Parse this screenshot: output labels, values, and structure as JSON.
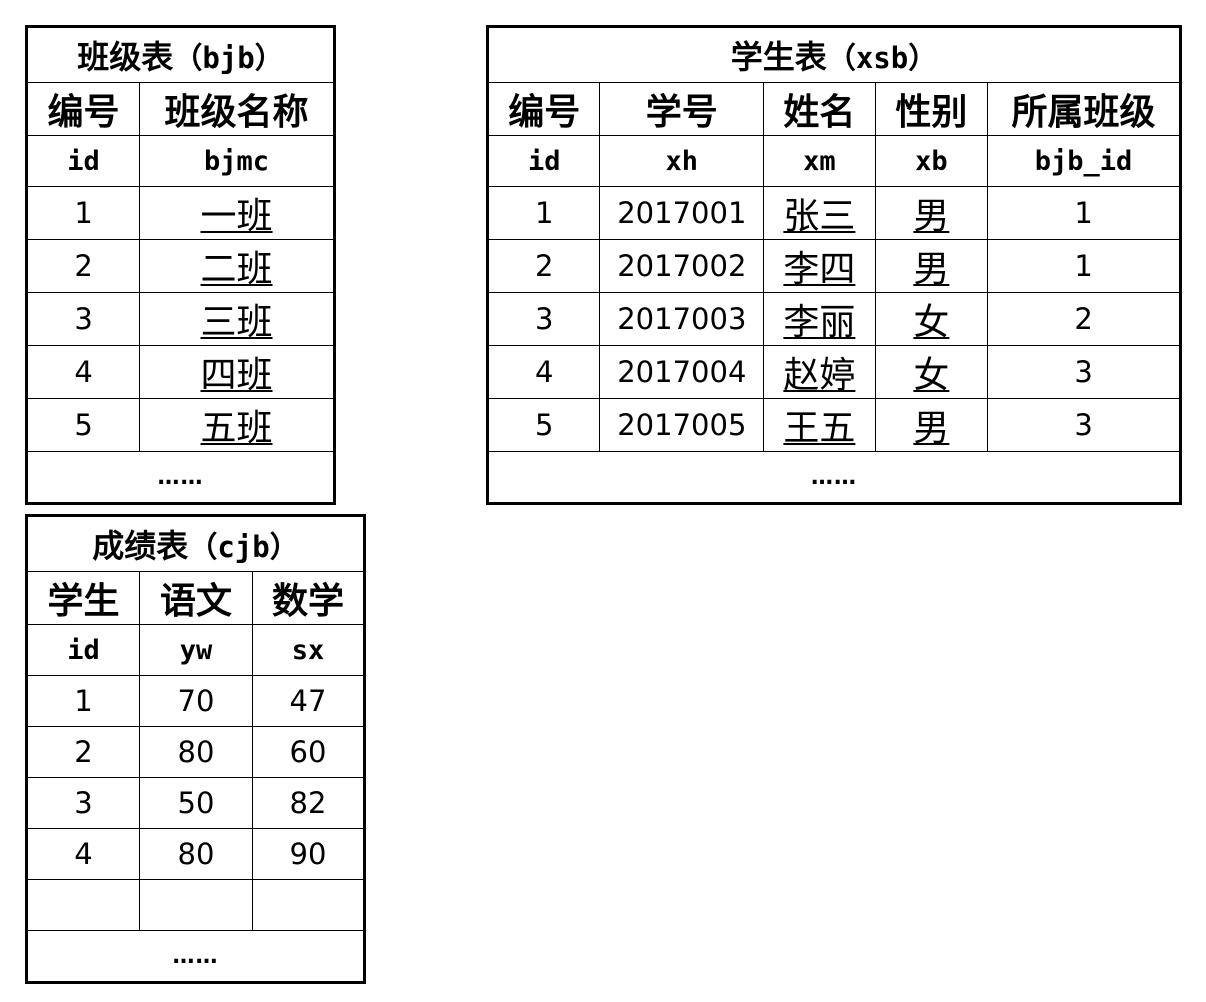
{
  "bjb": {
    "title_cn": "班级表",
    "title_en": "（bjb）",
    "headers_cn": [
      "编号",
      "班级名称"
    ],
    "fields": [
      "id",
      "bjmc"
    ],
    "rows": [
      [
        "1",
        "一班"
      ],
      [
        "2",
        "二班"
      ],
      [
        "3",
        "三班"
      ],
      [
        "4",
        "四班"
      ],
      [
        "5",
        "五班"
      ]
    ],
    "ellipsis": "……"
  },
  "xsb": {
    "title_cn": "学生表",
    "title_en": "（xsb）",
    "headers_cn": [
      "编号",
      "学号",
      "姓名",
      "性别",
      "所属班级"
    ],
    "fields": [
      "id",
      "xh",
      "xm",
      "xb",
      "bjb_id"
    ],
    "rows": [
      [
        "1",
        "2017001",
        "张三",
        "男",
        "1"
      ],
      [
        "2",
        "2017002",
        "李四",
        "男",
        "1"
      ],
      [
        "3",
        "2017003",
        "李丽",
        "女",
        "2"
      ],
      [
        "4",
        "2017004",
        "赵婷",
        "女",
        "3"
      ],
      [
        "5",
        "2017005",
        "王五",
        "男",
        "3"
      ]
    ],
    "ellipsis": "……"
  },
  "cjb": {
    "title_cn": "成绩表",
    "title_en": "（cjb）",
    "headers_cn": [
      "学生",
      "语文",
      "数学"
    ],
    "fields": [
      "id",
      "yw",
      "sx"
    ],
    "rows": [
      [
        "1",
        "70",
        "47"
      ],
      [
        "2",
        "80",
        "60"
      ],
      [
        "3",
        "50",
        "82"
      ],
      [
        "4",
        "80",
        "90"
      ]
    ],
    "ellipsis": "……"
  }
}
